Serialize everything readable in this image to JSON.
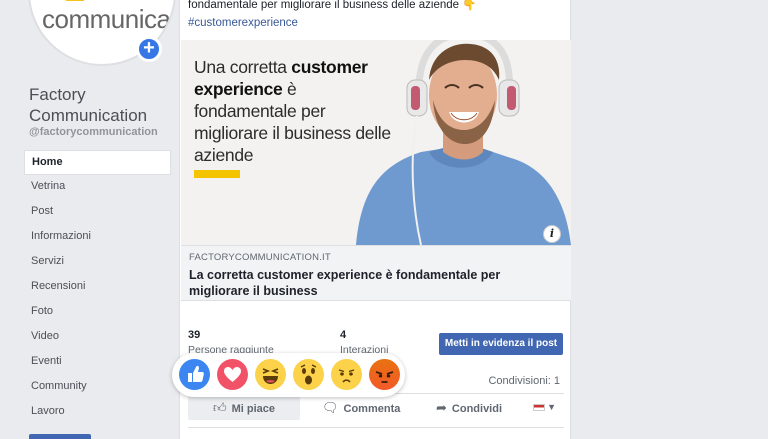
{
  "page": {
    "logo_text": "communication",
    "name": "Factory Communication",
    "handle": "@factorycommunication"
  },
  "nav": {
    "items": [
      "Home",
      "Vetrina",
      "Post",
      "Informazioni",
      "Servizi",
      "Recensioni",
      "Foto",
      "Video",
      "Eventi",
      "Community",
      "Lavoro"
    ],
    "active": "Home"
  },
  "post": {
    "text": "fondamentale per migliorare il business delle aziende 👇",
    "hashtag": "#customerexperience",
    "image_headline_part1": "Una corretta ",
    "image_headline_bold1": "customer experience",
    "image_headline_part2": " è fondamentale per migliorare il business delle aziende",
    "link_domain": "FACTORYCOMMUNICATION.IT",
    "link_title": "La corretta customer experience è fondamentale per migliorare il business"
  },
  "insights": {
    "reach_value": "39",
    "reach_label": "Persone raggiunte",
    "interactions_value": "4",
    "interactions_label": "Interazioni",
    "boost_label": "Metti in evidenza il post"
  },
  "shares_text": "Condivisioni: 1",
  "actions": {
    "like": "Mi piace",
    "comment": "Commenta",
    "share": "Condividi"
  },
  "reactions": [
    "like",
    "love",
    "haha",
    "wow",
    "sad",
    "angry"
  ],
  "icons": {
    "add": "plus-icon",
    "info": "info-icon",
    "like": "thumbs-up-icon",
    "comment": "speech-bubble-icon",
    "share": "share-arrow-icon",
    "audience": "flag-icon"
  },
  "colors": {
    "brand_blue": "#4267b2",
    "link_blue": "#385898",
    "accent_yellow": "#f5c400",
    "background": "#e9ebee"
  }
}
